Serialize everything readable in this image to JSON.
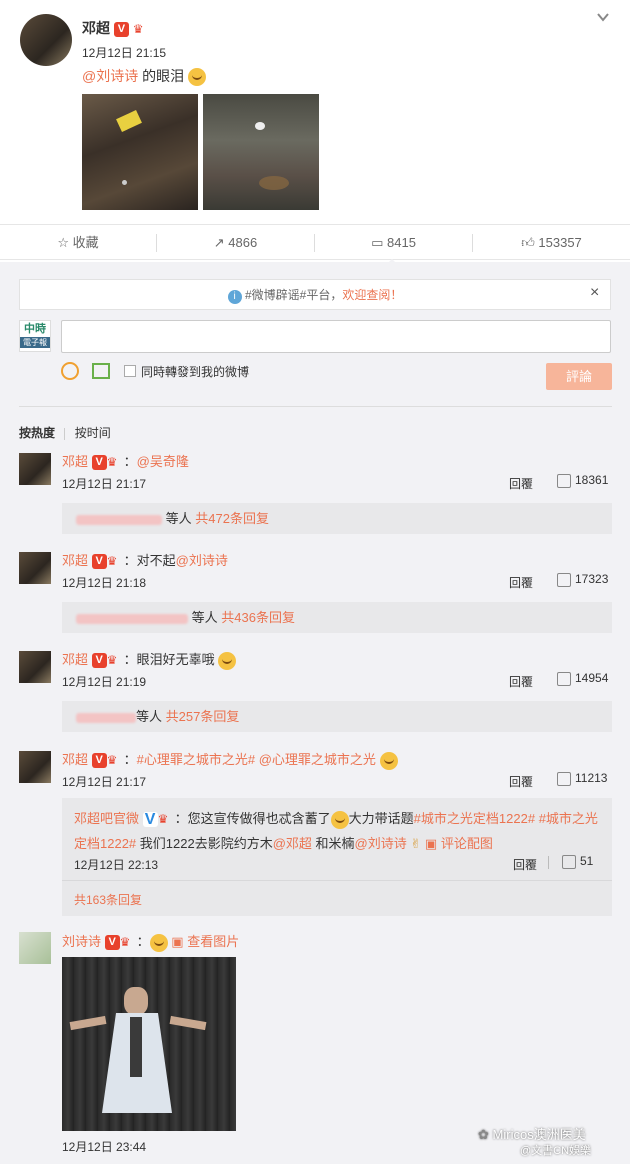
{
  "post": {
    "author": "邓超",
    "time": "12月12日 21:15",
    "mention": "@刘诗诗",
    "text": " 的眼泪",
    "menu_icon": "chevron-down-icon"
  },
  "actions": {
    "favorite": "收藏",
    "repost": "4866",
    "comment": "8415",
    "like": "153357"
  },
  "notice": {
    "tag": "#微博辟谣#平台，",
    "link": "欢迎查阅！",
    "close": "×"
  },
  "composer": {
    "avatar_text_1": "中時",
    "avatar_text_2": "電子報",
    "sync_label": "同時轉發到我的微博",
    "submit": "評論"
  },
  "sort": {
    "hot": "按热度",
    "time": "按时间"
  },
  "comments": [
    {
      "author": "邓超",
      "text": "：",
      "mention": "@吴奇隆",
      "time": "12月12日 21:17",
      "reply": "回覆",
      "likes": "18361",
      "strip_suffix": "等人",
      "strip_count": "共472条回复"
    },
    {
      "author": "邓超",
      "text": "：对不起",
      "mention": "@刘诗诗",
      "time": "12月12日 21:18",
      "reply": "回覆",
      "likes": "17323",
      "strip_suffix": "等人",
      "strip_count": "共436条回复"
    },
    {
      "author": "邓超",
      "text": "：眼泪好无辜哦",
      "mention": "",
      "time": "12月12日 21:19",
      "reply": "回覆",
      "likes": "14954",
      "strip_suffix": "等人",
      "strip_count": "共257条回复"
    },
    {
      "author": "邓超",
      "text": "：",
      "mention": "#心理罪之城市之光# @心理罪之城市之光",
      "time": "12月12日 21:17",
      "reply": "回覆",
      "likes": "11213"
    }
  ],
  "sub_reply": {
    "author": "邓超吧官微",
    "text1": "：您这宣传做得也忒含蓄了",
    "text2": "大力带话题",
    "tag1": "#城市之光定档1222#",
    "tag2": "#城市之光",
    "tag2b": "定档1222#",
    "text3": " 我们1222去影院约方木",
    "mention1": "@邓超",
    "text4": " 和米楠",
    "mention2": "@刘诗诗",
    "pic_label": "评论配图",
    "time": "12月12日 22:13",
    "reply": "回覆",
    "likes": "51",
    "total": "共163条回复"
  },
  "last_comment": {
    "author": "刘诗诗",
    "colon": "：",
    "view_pic": "查看图片",
    "time": "12月12日 23:44"
  },
  "watermark": {
    "brand": "Miricos澳洲医美",
    "sub": "@文書CN娛樂"
  },
  "colors": {
    "accent": "#eb7350",
    "submit_bg": "#f7b59a",
    "background": "#f2f2f5"
  }
}
